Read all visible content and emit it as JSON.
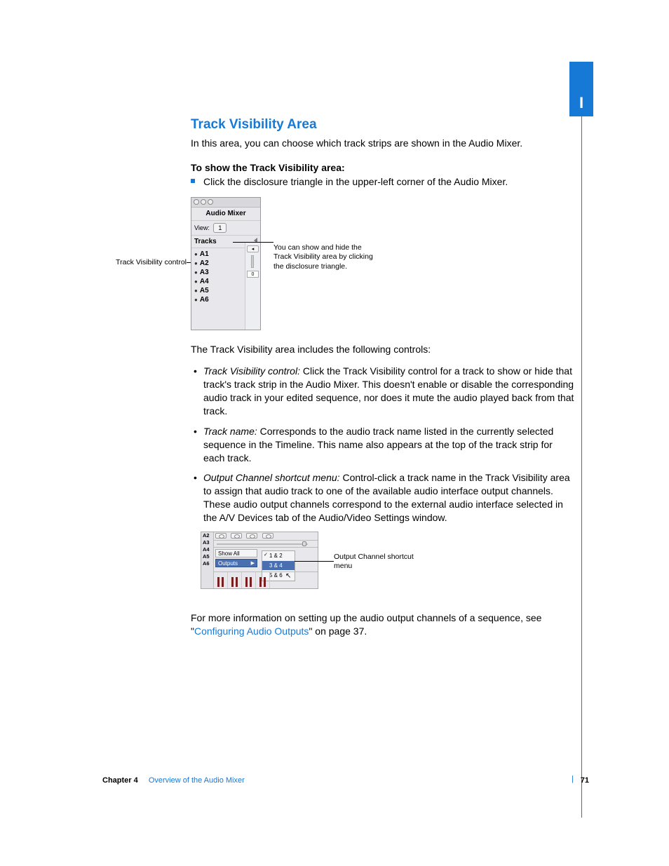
{
  "part_label": "I",
  "heading": "Track Visibility Area",
  "intro": "In this area, you can choose which track strips are shown in the Audio Mixer.",
  "procedure_title": "To show the Track Visibility area:",
  "procedure_step": "Click the disclosure triangle in the upper-left corner of the Audio Mixer.",
  "fig1": {
    "tab_title": "Audio Mixer",
    "view_label": "View:",
    "view_button": "1",
    "tracks_label": "Tracks",
    "tracks": [
      "A1",
      "A2",
      "A3",
      "A4",
      "A5",
      "A6"
    ],
    "right_value": "0",
    "callout_left": "Track Visibility control",
    "callout_right": "You can show and hide the Track Visibility area by clicking the disclosure triangle."
  },
  "after_fig1": "The Track Visibility area includes the following controls:",
  "controls": [
    {
      "term": "Track Visibility control:",
      "desc": "Click the Track Visibility control for a track to show or hide that track's track strip in the Audio Mixer. This doesn't enable or disable the corresponding audio track in your edited sequence, nor does it mute the audio played back from that track."
    },
    {
      "term": "Track name:",
      "desc": "Corresponds to the audio track name listed in the currently selected sequence in the Timeline. This name also appears at the top of the track strip for each track."
    },
    {
      "term": "Output Channel shortcut menu:",
      "desc": "Control-click a track name in the Track Visibility area to assign that audio track to one of the available audio interface output channels. These audio output channels correspond to the external audio interface selected in the A/V Devices tab of the Audio/Video Settings window."
    }
  ],
  "fig2": {
    "left_tracks": [
      "A2",
      "A3",
      "A4",
      "A5",
      "A6"
    ],
    "menu_showall": "Show All",
    "menu_outputs": "Outputs",
    "submenu": [
      "1 & 2",
      "3 & 4",
      "5 & 6"
    ],
    "callout": "Output Channel shortcut menu"
  },
  "closing_before_link": "For more information on setting up the audio output channels of a sequence, see \"",
  "closing_link": "Configuring Audio Outputs",
  "closing_after_link": "\" on page 37.",
  "footer": {
    "chapter": "Chapter 4",
    "title": "Overview of the Audio Mixer",
    "page": "71"
  }
}
